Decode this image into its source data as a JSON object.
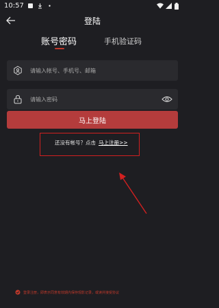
{
  "status_bar": {
    "time": "10:57"
  },
  "header": {
    "title": "登陆"
  },
  "tabs": [
    {
      "label": "账号密码",
      "active": true
    },
    {
      "label": "手机验证码",
      "active": false
    }
  ],
  "form": {
    "account_placeholder": "请输入帐号、手机号、邮箱",
    "password_placeholder": "请输入密码",
    "login_label": "马上登陆"
  },
  "register": {
    "prompt": "还没有帐号？点击",
    "link": "马上注册>>"
  },
  "agreement": {
    "text": "登录注册，即表示同意有效期内保存观影记录，或读并接受协议"
  },
  "colors": {
    "background": "#1e1e22",
    "field": "#2a2a2e",
    "accent": "#b43c3c",
    "annotation": "#d22020"
  }
}
